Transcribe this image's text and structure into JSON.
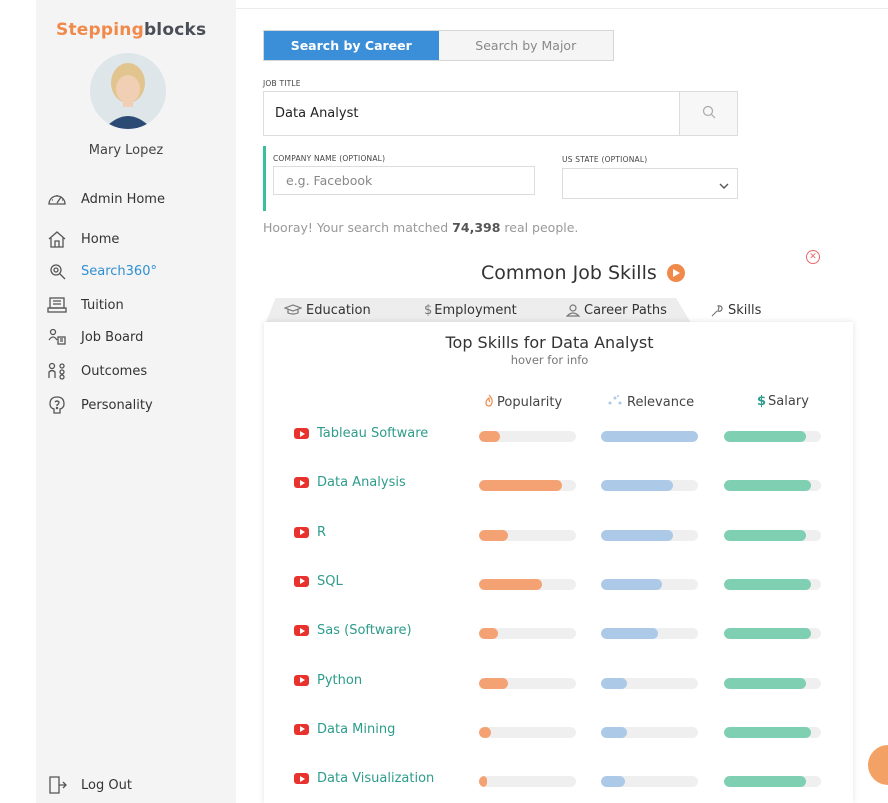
{
  "sidebar": {
    "logo": {
      "part1": "Stepping",
      "part2": "blocks"
    },
    "username": "Mary Lopez",
    "items": [
      {
        "label": "Admin Home",
        "icon": "gauge-icon"
      },
      {
        "label": "Home",
        "icon": "home-icon"
      },
      {
        "label": "Search360°",
        "icon": "search360-icon",
        "active": true
      },
      {
        "label": "Tuition",
        "icon": "tuition-icon"
      },
      {
        "label": "Job Board",
        "icon": "job-board-icon"
      },
      {
        "label": "Outcomes",
        "icon": "outcomes-icon"
      },
      {
        "label": "Personality",
        "icon": "personality-icon"
      }
    ],
    "logout": "Log Out"
  },
  "search": {
    "toggle_career": "Search by Career",
    "toggle_major": "Search by Major",
    "job_title_label": "JOB TITLE",
    "job_title_value": "Data Analyst",
    "company_label": "COMPANY NAME (OPTIONAL)",
    "company_placeholder": "e.g. Facebook",
    "state_label": "US STATE (OPTIONAL)",
    "hooray_prefix": "Hooray! Your search matched ",
    "hooray_count": "74,398",
    "hooray_suffix": " real people."
  },
  "section": {
    "title": "Common Job Skills"
  },
  "tabs": [
    "Education",
    "Employment",
    "Career Paths",
    "Skills"
  ],
  "card": {
    "title": "Top Skills for Data Analyst",
    "subtitle": "hover for info",
    "col_popularity": "Popularity",
    "col_relevance": "Relevance",
    "col_salary": "Salary",
    "salary_symbol": "$"
  },
  "skills": [
    {
      "name": "Tableau Software",
      "popularity": 0.22,
      "relevance": 1.0,
      "salary": 0.85
    },
    {
      "name": "Data Analysis",
      "popularity": 0.86,
      "relevance": 0.74,
      "salary": 0.9
    },
    {
      "name": "R",
      "popularity": 0.3,
      "relevance": 0.74,
      "salary": 0.85
    },
    {
      "name": "SQL",
      "popularity": 0.65,
      "relevance": 0.63,
      "salary": 0.9
    },
    {
      "name": "Sas (Software)",
      "popularity": 0.2,
      "relevance": 0.59,
      "salary": 0.9
    },
    {
      "name": "Python",
      "popularity": 0.3,
      "relevance": 0.27,
      "salary": 0.85
    },
    {
      "name": "Data Mining",
      "popularity": 0.12,
      "relevance": 0.27,
      "salary": 0.9
    },
    {
      "name": "Data Visualization",
      "popularity": 0.08,
      "relevance": 0.25,
      "salary": 0.85
    }
  ],
  "colors": {
    "accent_blue": "#3b8fd9",
    "accent_orange": "#f08a4b",
    "teal": "#2e9c8b",
    "popularity": "#f4a273",
    "relevance": "#adc9e8",
    "salary": "#7fcfb3"
  }
}
